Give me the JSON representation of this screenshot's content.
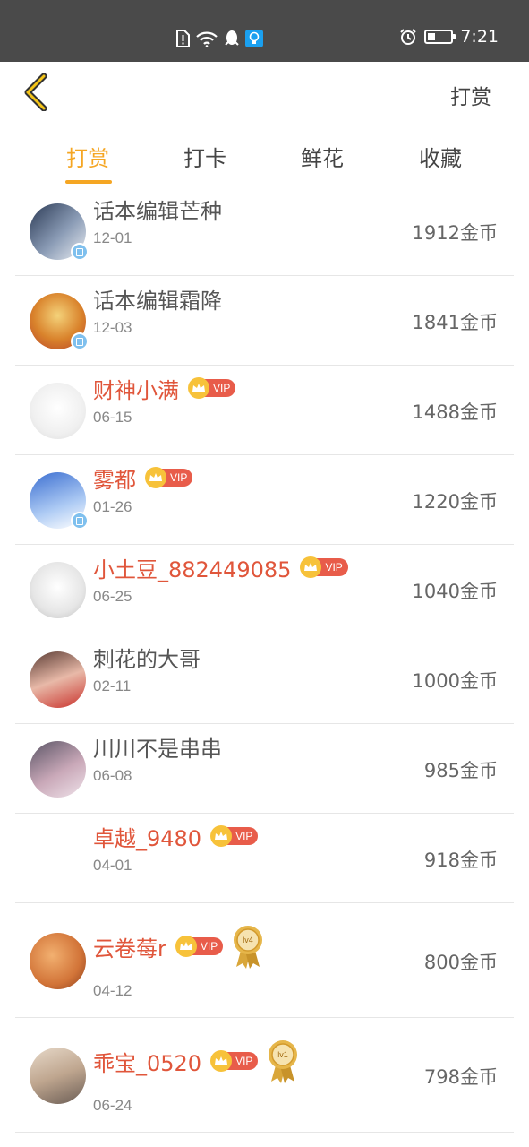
{
  "status_bar": {
    "time": "7:21",
    "center_icons": [
      "sim-alert-icon",
      "wifi-icon",
      "qq-penguin-icon",
      "lightbulb-app-icon"
    ],
    "right_icons": [
      "alarm-icon",
      "battery-icon"
    ],
    "battery_level": 0.3
  },
  "navbar": {
    "back_icon": "chevron-left-icon",
    "action_label": "打赏"
  },
  "tabs": [
    {
      "label": "打赏",
      "active": true
    },
    {
      "label": "打卡",
      "active": false
    },
    {
      "label": "鲜花",
      "active": false
    },
    {
      "label": "收藏",
      "active": false
    }
  ],
  "colors": {
    "accent": "#f5a623",
    "vip_name": "#e0563b",
    "normal_name": "#555555",
    "vip_badge": "#e85c4a",
    "crown": "#f7c23a",
    "verified_badge": "#7fc0ee"
  },
  "entries": [
    {
      "name": "话本编辑芒种",
      "date": "12-01",
      "amount": "1912金币",
      "vip": false,
      "verified": true,
      "medal": null
    },
    {
      "name": "话本编辑霜降",
      "date": "12-03",
      "amount": "1841金币",
      "vip": false,
      "verified": true,
      "medal": null
    },
    {
      "name": "财神小满",
      "date": "06-15",
      "amount": "1488金币",
      "vip": true,
      "verified": false,
      "medal": null
    },
    {
      "name": "雾都",
      "date": "01-26",
      "amount": "1220金币",
      "vip": true,
      "verified": true,
      "medal": null
    },
    {
      "name": "小土豆_882449085",
      "date": "06-25",
      "amount": "1040金币",
      "vip": true,
      "verified": false,
      "medal": null
    },
    {
      "name": "刺花的大哥",
      "date": "02-11",
      "amount": "1000金币",
      "vip": false,
      "verified": false,
      "medal": null
    },
    {
      "name": "川川不是串串",
      "date": "06-08",
      "amount": "985金币",
      "vip": false,
      "verified": false,
      "medal": null
    },
    {
      "name": "卓越_9480",
      "date": "04-01",
      "amount": "918金币",
      "vip": true,
      "verified": false,
      "medal": null
    },
    {
      "name": "云卷莓r",
      "date": "04-12",
      "amount": "800金币",
      "vip": true,
      "verified": false,
      "medal": "lv4"
    },
    {
      "name": "乖宝_0520",
      "date": "06-24",
      "amount": "798金币",
      "vip": true,
      "verified": false,
      "medal": "lv1"
    }
  ],
  "vip_label": "VIP"
}
